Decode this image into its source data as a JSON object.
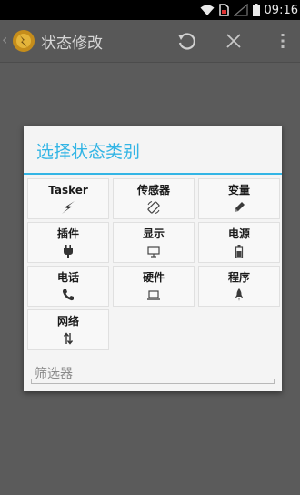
{
  "status_bar": {
    "time": "09:16",
    "icons": [
      "wifi-icon",
      "sim-icon",
      "signal-icon",
      "battery-icon"
    ]
  },
  "action_bar": {
    "title": "状态修改",
    "buttons": [
      "undo-icon",
      "close-icon",
      "overflow-menu-icon"
    ]
  },
  "dialog": {
    "title": "选择状态类别",
    "accent": "#33b5e5",
    "categories": [
      {
        "label": "Tasker",
        "icon": "lightning-icon"
      },
      {
        "label": "传感器",
        "icon": "rotate-icon"
      },
      {
        "label": "变量",
        "icon": "pencil-icon"
      },
      {
        "label": "插件",
        "icon": "plug-icon"
      },
      {
        "label": "显示",
        "icon": "monitor-icon"
      },
      {
        "label": "电源",
        "icon": "battery-icon"
      },
      {
        "label": "电话",
        "icon": "phone-icon"
      },
      {
        "label": "硬件",
        "icon": "laptop-icon"
      },
      {
        "label": "程序",
        "icon": "rocket-icon"
      },
      {
        "label": "网络",
        "icon": "transfer-arrows-icon"
      }
    ],
    "filter_placeholder": "筛选器"
  }
}
